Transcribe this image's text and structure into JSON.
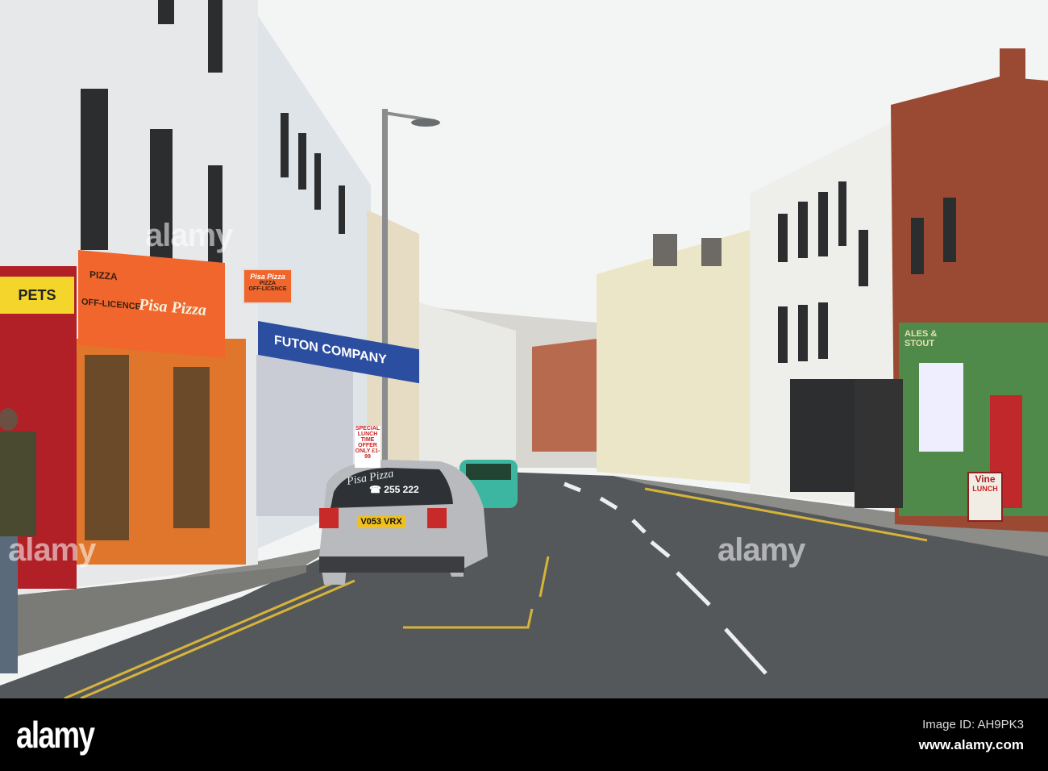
{
  "signs": {
    "pets": "PETS",
    "pizza": "PIZZA",
    "off_licence": "OFF-LICENCE",
    "pisa_pizza": "Pisa Pizza",
    "hanging_pizza": "PIZZA",
    "hanging_off_licence": "OFF-LICENCE",
    "futon": "FUTON COMPANY",
    "lunch_offer": "SPECIAL LUNCH TIME OFFER ONLY £1-99",
    "ales_stout": "ALES & STOUT",
    "vine": "Vine",
    "lunch": "LUNCH"
  },
  "car": {
    "brand": "Pisa Pizza",
    "phone": "☎ 255 222",
    "plate": "V053 VRX"
  },
  "watermarks": [
    "alamy",
    "alamy",
    "alamy"
  ],
  "footer": {
    "logo": "alamy",
    "image_id": "Image ID: AH9PK3",
    "url": "www.alamy.com"
  }
}
